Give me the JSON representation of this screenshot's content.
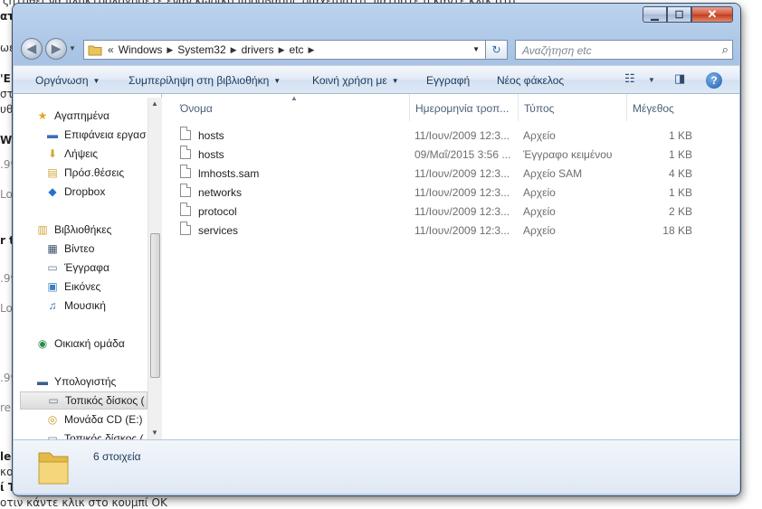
{
  "background": {
    "lines": [
      "ζητηθεί να πληκτρολογήσετε έναν κωδικό πρόσβασης διαχειριστή, πατήστε ή κάντε κλικ στο",
      "ατι",
      "ωε",
      "'Ε",
      "στ",
      "υθ",
      "Wi",
      ".99",
      "Lo",
      "r t",
      ".99",
      "Lo",
      ".99",
      "re",
      "le)",
      "κο",
      "ί Τ",
      "οτιν κάντε κλικ στο κουμπί ΟΚ"
    ]
  },
  "window": {
    "buttons": {
      "minimize": "▁",
      "maximize": "☐",
      "close": "✕"
    }
  },
  "nav": {
    "back": "◀",
    "forward": "▶",
    "address_chevron": "«",
    "path": [
      "Windows",
      "System32",
      "drivers",
      "etc"
    ],
    "search_placeholder": "Αναζήτηση etc"
  },
  "toolbar": {
    "organize": "Οργάνωση",
    "include_library": "Συμπερίληψη στη βιβλιοθήκη",
    "share_with": "Κοινή χρήση με",
    "burn": "Εγγραφή",
    "new_folder": "Νέος φάκελος",
    "help": "?"
  },
  "sidebar": {
    "items": [
      {
        "label": "Αγαπημένα",
        "icon": "star-icon",
        "indent": 0
      },
      {
        "label": "Επιφάνεια εργασ",
        "icon": "desktop-icon",
        "indent": 1
      },
      {
        "label": "Λήψεις",
        "icon": "downloads-icon",
        "indent": 1
      },
      {
        "label": "Πρόσ.θέσεις",
        "icon": "recent-places-icon",
        "indent": 1
      },
      {
        "label": "Dropbox",
        "icon": "dropbox-icon",
        "indent": 1
      },
      {
        "label": "Βιβλιοθήκες",
        "icon": "libraries-icon",
        "indent": 0
      },
      {
        "label": "Βίντεο",
        "icon": "video-icon",
        "indent": 1
      },
      {
        "label": "Έγγραφα",
        "icon": "documents-icon",
        "indent": 1
      },
      {
        "label": "Εικόνες",
        "icon": "pictures-icon",
        "indent": 1
      },
      {
        "label": "Μουσική",
        "icon": "music-icon",
        "indent": 1
      },
      {
        "label": "Οικιακή ομάδα",
        "icon": "homegroup-icon",
        "indent": 0
      },
      {
        "label": "Υπολογιστής",
        "icon": "computer-icon",
        "indent": 0
      },
      {
        "label": "Τοπικός δίσκος (",
        "icon": "local-disk-icon",
        "indent": 1,
        "selected": true
      },
      {
        "label": "Μονάδα CD (E:)",
        "icon": "cd-drive-icon",
        "indent": 1
      },
      {
        "label": "Τοπικός δίσκος (",
        "icon": "local-disk-icon",
        "indent": 1
      }
    ]
  },
  "columns": {
    "name": "Όνομα",
    "date": "Ημερομηνία τροπ...",
    "type": "Τύπος",
    "size": "Μέγεθος"
  },
  "files": [
    {
      "name": "hosts",
      "date": "11/Ιουν/2009 12:3...",
      "type": "Αρχείο",
      "size": "1 KB"
    },
    {
      "name": "hosts",
      "date": "09/Μαΐ/2015 3:56 ...",
      "type": "Έγγραφο κειμένου",
      "size": "1 KB"
    },
    {
      "name": "lmhosts.sam",
      "date": "11/Ιουν/2009 12:3...",
      "type": "Αρχείο SAM",
      "size": "4 KB"
    },
    {
      "name": "networks",
      "date": "11/Ιουν/2009 12:3...",
      "type": "Αρχείο",
      "size": "1 KB"
    },
    {
      "name": "protocol",
      "date": "11/Ιουν/2009 12:3...",
      "type": "Αρχείο",
      "size": "2 KB"
    },
    {
      "name": "services",
      "date": "11/Ιουν/2009 12:3...",
      "type": "Αρχείο",
      "size": "18 KB"
    }
  ],
  "status": {
    "count": "6 στοιχεία"
  },
  "colors": {
    "toolbar_text": "#1e395b",
    "selected_bg": "#dcdcdc",
    "folder": "#e9c55a"
  }
}
